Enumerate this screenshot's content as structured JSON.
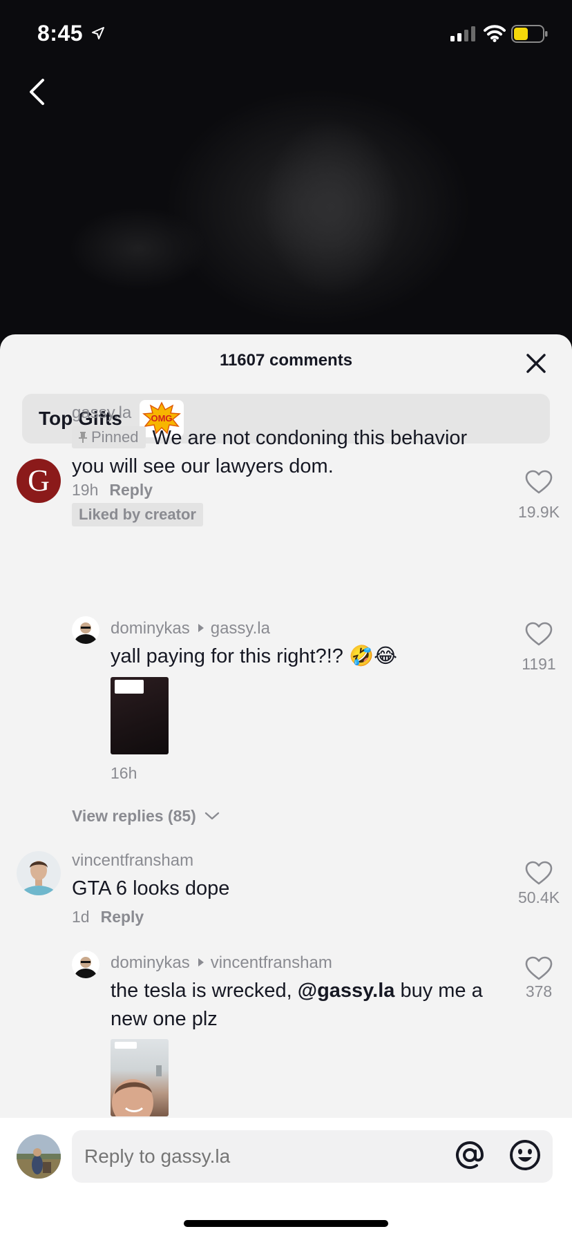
{
  "status_bar": {
    "time": "8:45"
  },
  "sheet": {
    "title": "11607 comments"
  },
  "top_gifts": {
    "label": "Top Gifts",
    "gift_text": "OMG"
  },
  "comments": [
    {
      "username": "gassy.la",
      "pinned_label": "Pinned",
      "text": "We are not condoning this behavior you will see our lawyers dom.",
      "age": "19h",
      "reply_label": "Reply",
      "liked_by_creator": "Liked by creator",
      "likes": "19.9K",
      "replies": [
        {
          "username": "dominykas",
          "reply_to": "gassy.la",
          "text": "yall paying for this right?!? 🤣😂",
          "age": "16h",
          "likes": "1191"
        }
      ],
      "view_replies": "View replies (85)"
    },
    {
      "username": "vincentfransham",
      "text": "GTA 6 looks dope",
      "age": "1d",
      "reply_label": "Reply",
      "likes": "50.4K",
      "replies": [
        {
          "username": "dominykas",
          "reply_to": "vincentfransham",
          "text_before": "the tesla is wrecked, ",
          "mention": "@gassy.la",
          "text_after": " buy me a new one plz",
          "likes": "378"
        }
      ]
    }
  ],
  "input": {
    "placeholder": "Reply to gassy.la"
  }
}
